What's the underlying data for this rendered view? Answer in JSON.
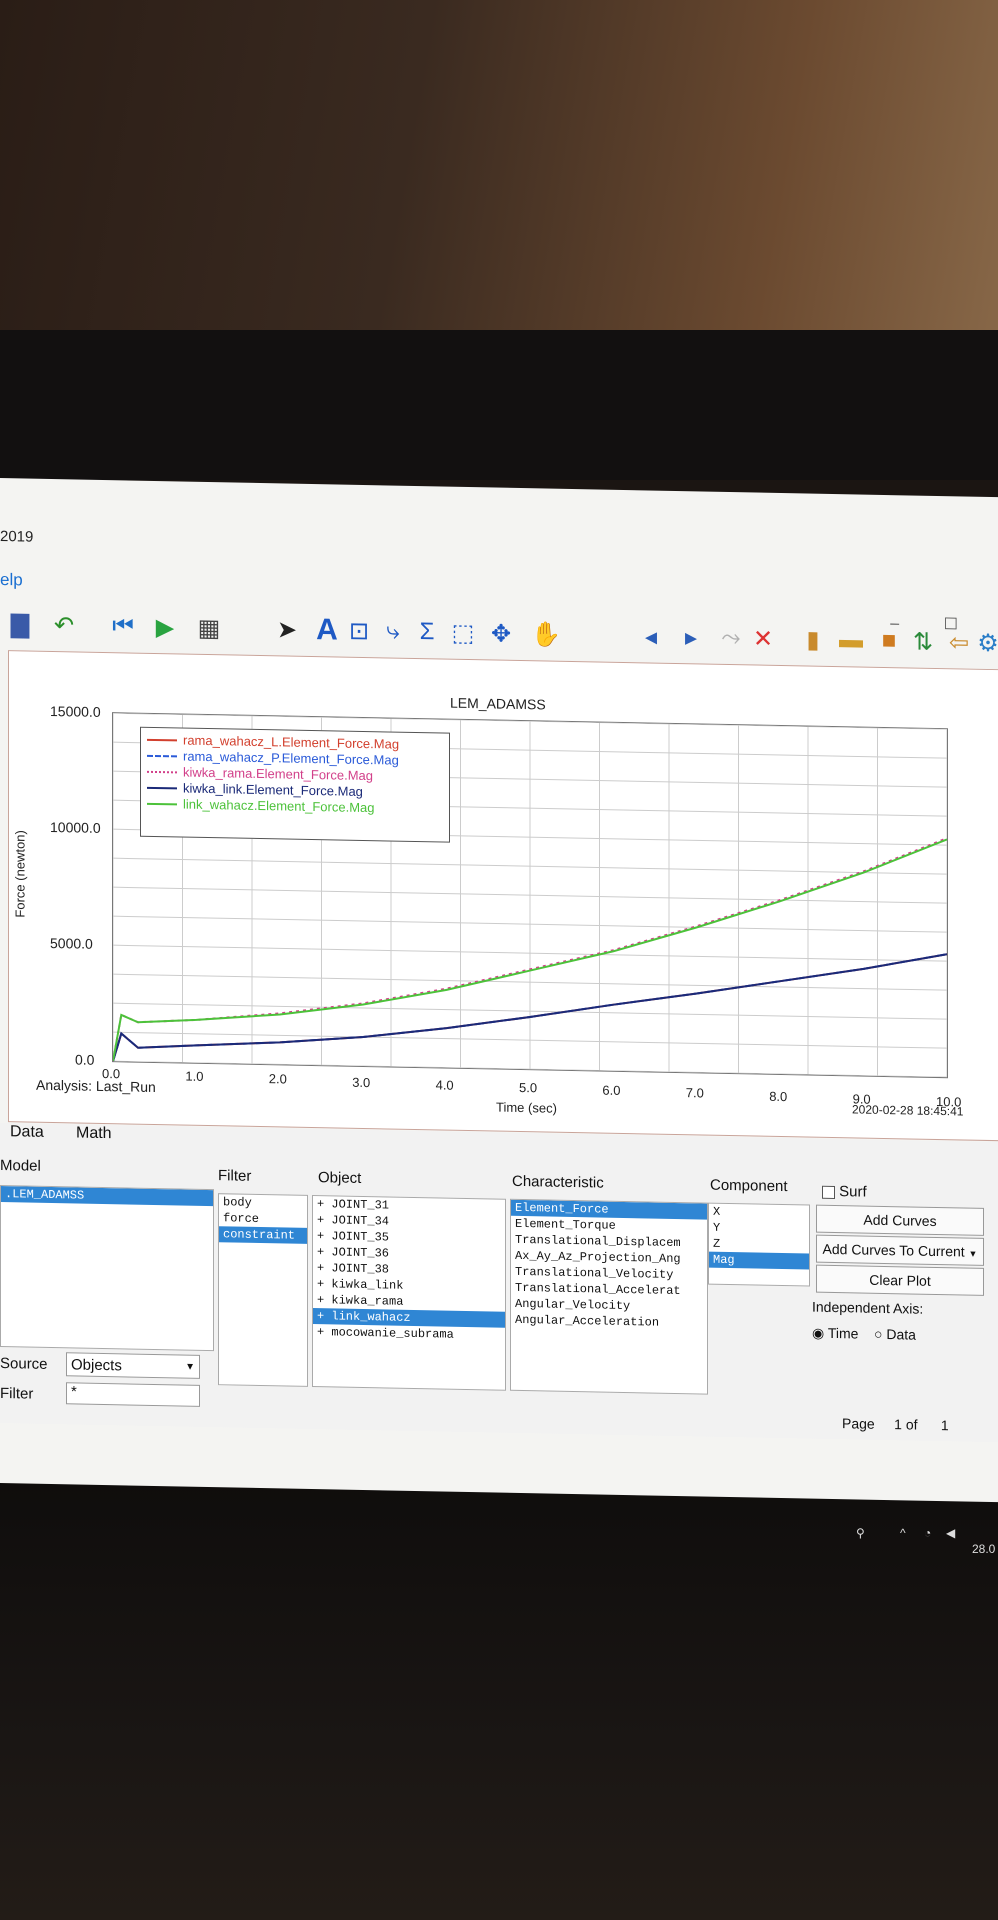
{
  "window": {
    "title_fragment": "2019",
    "menu_fragment": "elp",
    "minimize": "–",
    "maximize": "☐"
  },
  "toolbar": {
    "icons": [
      "printer-icon",
      "undo-icon",
      "rewind-icon",
      "play-icon",
      "film-icon",
      "select-arrow-icon",
      "text-icon",
      "box-icon",
      "plot-icon",
      "sigma-icon",
      "zoom-icon",
      "fit-icon",
      "pan-hand-icon",
      "step-back-icon",
      "step-forward-icon",
      "curve-edit-icon",
      "delete-icon",
      "layout-1-icon",
      "layout-2-icon",
      "layout-3-icon",
      "export-icon",
      "back-icon",
      "settings-icon"
    ],
    "text_tool": "A",
    "sigma": "Σ"
  },
  "plot": {
    "title": "LEM_ADAMSS",
    "ylabel": "Force (newton)",
    "xlabel": "Time (sec)",
    "analysis": "Analysis:  Last_Run",
    "timestamp": "2020-02-28 18:45:41",
    "ytick_labels": [
      "15000.0",
      "10000.0",
      "5000.0",
      "0.0"
    ],
    "xtick_labels": [
      "0.0",
      "1.0",
      "2.0",
      "3.0",
      "4.0",
      "5.0",
      "6.0",
      "7.0",
      "8.0",
      "9.0",
      "10.0"
    ]
  },
  "chart_data": {
    "type": "line",
    "title": "LEM_ADAMSS",
    "xlabel": "Time (sec)",
    "ylabel": "Force (newton)",
    "xlim": [
      0,
      10
    ],
    "ylim": [
      0,
      15000
    ],
    "grid": true,
    "legend_placement": "top-left",
    "x": [
      0,
      0.1,
      0.3,
      1,
      2,
      3,
      4,
      5,
      6,
      7,
      8,
      9,
      10
    ],
    "series": [
      {
        "name": "rama_wahacz_L.Element_Force.Mag",
        "color": "#d2402e",
        "dash": "solid",
        "values": [
          0,
          1200,
          600,
          750,
          950,
          1250,
          1700,
          2250,
          2850,
          3400,
          4000,
          4600,
          5300
        ]
      },
      {
        "name": "rama_wahacz_P.Element_Force.Mag",
        "color": "#2a5ad8",
        "dash": "dashed",
        "values": [
          0,
          1200,
          600,
          750,
          950,
          1250,
          1700,
          2250,
          2850,
          3400,
          4000,
          4600,
          5300
        ]
      },
      {
        "name": "kiwka_rama.Element_Force.Mag",
        "color": "#d2408a",
        "dash": "dotted",
        "values": [
          0,
          2000,
          1700,
          1850,
          2200,
          2700,
          3400,
          4300,
          5200,
          6300,
          7500,
          8800,
          10300
        ]
      },
      {
        "name": "kiwka_link.Element_Force.Mag",
        "color": "#1b2a78",
        "dash": "solid",
        "values": [
          0,
          1200,
          600,
          750,
          950,
          1250,
          1700,
          2250,
          2850,
          3400,
          4000,
          4600,
          5300
        ]
      },
      {
        "name": "link_wahacz.Element_Force.Mag",
        "color": "#4cc23a",
        "dash": "solid",
        "values": [
          0,
          2000,
          1700,
          1850,
          2150,
          2650,
          3350,
          4250,
          5150,
          6250,
          7450,
          8750,
          10250
        ]
      }
    ]
  },
  "panel": {
    "tabs": [
      "Data",
      "Math"
    ],
    "model_label": "Model",
    "model_items": [
      ".LEM_ADAMSS"
    ],
    "source_label": "Source",
    "source_value": "Objects",
    "filter_label": "Filter",
    "filter_value": "*",
    "filter_col_label": "Filter",
    "filter_items": [
      "body",
      "force",
      "constraint"
    ],
    "object_label": "Object",
    "object_items": [
      "+ JOINT_31",
      "+ JOINT_34",
      "+ JOINT_35",
      "+ JOINT_36",
      "+ JOINT_38",
      "+ kiwka_link",
      "+ kiwka_rama",
      "+ link_wahacz",
      "+ mocowanie_subrama"
    ],
    "characteristic_label": "Characteristic",
    "characteristic_items": [
      "Element_Force",
      "Element_Torque",
      "Translational_Displacem",
      "Ax_Ay_Az_Projection_Ang",
      "Translational_Velocity",
      "Translational_Accelerat",
      "Angular_Velocity",
      "Angular_Acceleration"
    ],
    "component_label": "Component",
    "component_items": [
      "X",
      "Y",
      "Z",
      "Mag"
    ],
    "surf_label": "Surf",
    "add_curves": "Add Curves",
    "add_curves_current": "Add Curves To Current",
    "clear_plot": "Clear Plot",
    "independent_axis": "Independent Axis:",
    "time_label": "Time",
    "data_label": "Data",
    "page_label": "Page",
    "page_current": "1",
    "page_of": "of",
    "page_total": "1"
  },
  "taskbar": {
    "date_fragment": "28.0"
  }
}
